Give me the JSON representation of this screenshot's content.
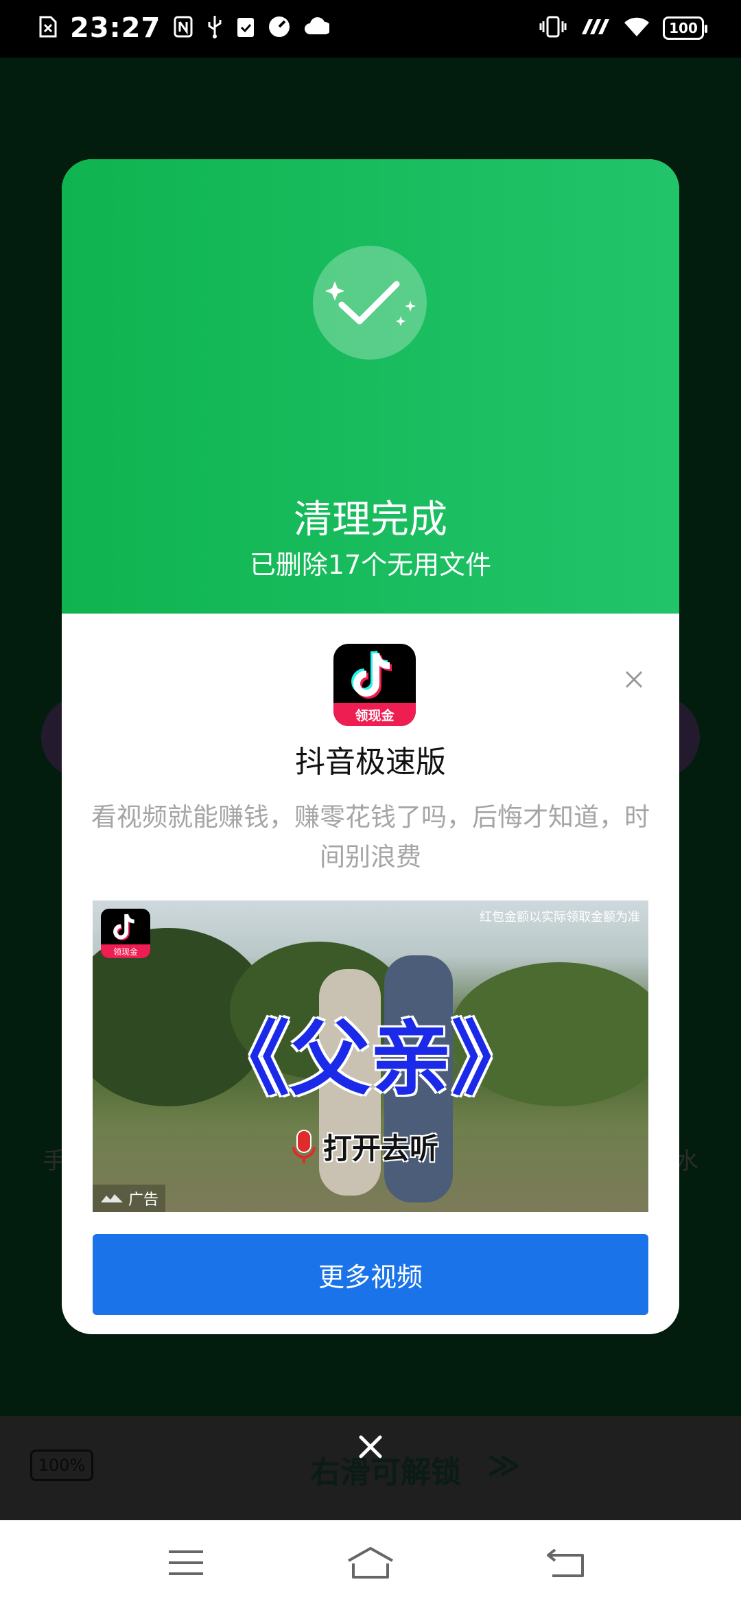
{
  "status_bar": {
    "time": "23:27",
    "battery": "100",
    "icons_left": [
      "sim-error-icon",
      "nfc-icon",
      "usb-icon",
      "clipboard-check-icon",
      "gauge-icon",
      "cloud-icon"
    ],
    "icons_right": [
      "vibrate-icon",
      "signal-icon",
      "wifi-icon",
      "battery-icon"
    ]
  },
  "background": {
    "left_hint": "手",
    "right_hint": "水",
    "lock_battery": "100%",
    "unlock_text": "右滑可解锁",
    "unlock_arrows": "≫"
  },
  "dialog": {
    "title": "清理完成",
    "subtitle": "已删除17个无用文件",
    "app_name": "抖音极速版",
    "app_icon_tag": "领现金",
    "description": "看视频就能赚钱，赚零花钱了吗，后悔才知道，时间别浪费",
    "ad_image": {
      "disclaimer": "红包金额以实际领取金额为准",
      "big_title": "《父亲》",
      "listen_text": "打开去听",
      "ad_label": "广告",
      "mini_icon_tag": "领现金"
    },
    "cta_button": "更多视频"
  },
  "colors": {
    "header_green_start": "#0fb450",
    "header_green_end": "#22c46a",
    "cta_blue": "#1a73e8",
    "tiktok_red": "#ee1d52",
    "tiktok_cyan": "#25f4ee"
  }
}
